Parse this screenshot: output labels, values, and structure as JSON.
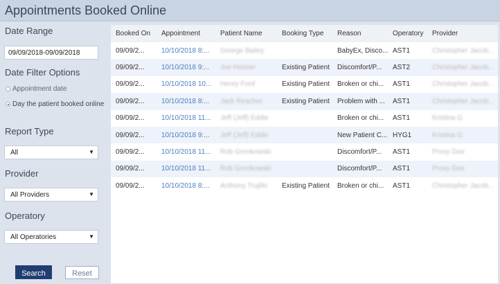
{
  "page": {
    "title": "Appointments Booked Online"
  },
  "filters": {
    "date_range_label": "Date Range",
    "date_range_value": "09/09/2018-09/09/2018",
    "date_filter_label": "Date Filter Options",
    "date_filter_options": [
      "Appointment date",
      "Day the patient booked online"
    ],
    "date_filter_selected": 1,
    "report_type_label": "Report Type",
    "report_type_value": "All",
    "provider_label": "Provider",
    "provider_value": "All Providers",
    "operatory_label": "Operatory",
    "operatory_value": "All Operatories",
    "search_label": "Search",
    "reset_label": "Reset"
  },
  "table": {
    "columns": [
      "Booked On",
      "Appointment",
      "Patient Name",
      "Booking Type",
      "Reason",
      "Operatory",
      "Provider"
    ],
    "rows": [
      [
        "09/09/2...",
        "10/10/2018 8:...",
        "George Bailey",
        "",
        "BabyEx, Disco...",
        "AST1",
        "Christopher Jacob..."
      ],
      [
        "09/09/2...",
        "10/10/2018 9:...",
        "Joe Hoover",
        "Existing Patient",
        "Discomfort/P...",
        "AST2",
        "Christopher Jacob..."
      ],
      [
        "09/09/2...",
        "10/10/2018 10...",
        "Henry Ford",
        "Existing Patient",
        "Broken or chi...",
        "AST1",
        "Christopher Jacob..."
      ],
      [
        "09/09/2...",
        "10/10/2018 8:...",
        "Jack Reacher",
        "Existing Patient",
        "Problem with ...",
        "AST1",
        "Christopher Jacob..."
      ],
      [
        "09/09/2...",
        "10/10/2018 11...",
        "Jeff (Jeff) Eddie",
        "",
        "Broken or chi...",
        "AST1",
        "Kristina G"
      ],
      [
        "09/09/2...",
        "10/10/2018 9:...",
        "Jeff (Jeff) Eddie",
        "",
        "New Patient C...",
        "HYG1",
        "Kristina G"
      ],
      [
        "09/09/2...",
        "10/10/2018 11...",
        "Rob Gronkowski",
        "",
        "Discomfort/P...",
        "AST1",
        "Proxy Doe"
      ],
      [
        "09/09/2...",
        "10/10/2018 11...",
        "Rob Gronkowski",
        "",
        "Discomfort/P...",
        "AST1",
        "Proxy Doe"
      ],
      [
        "09/09/2...",
        "10/10/2018 8:...",
        "Anthony Trujillo",
        "Existing Patient",
        "Broken or chi...",
        "AST1",
        "Christopher Jacob..."
      ]
    ]
  }
}
